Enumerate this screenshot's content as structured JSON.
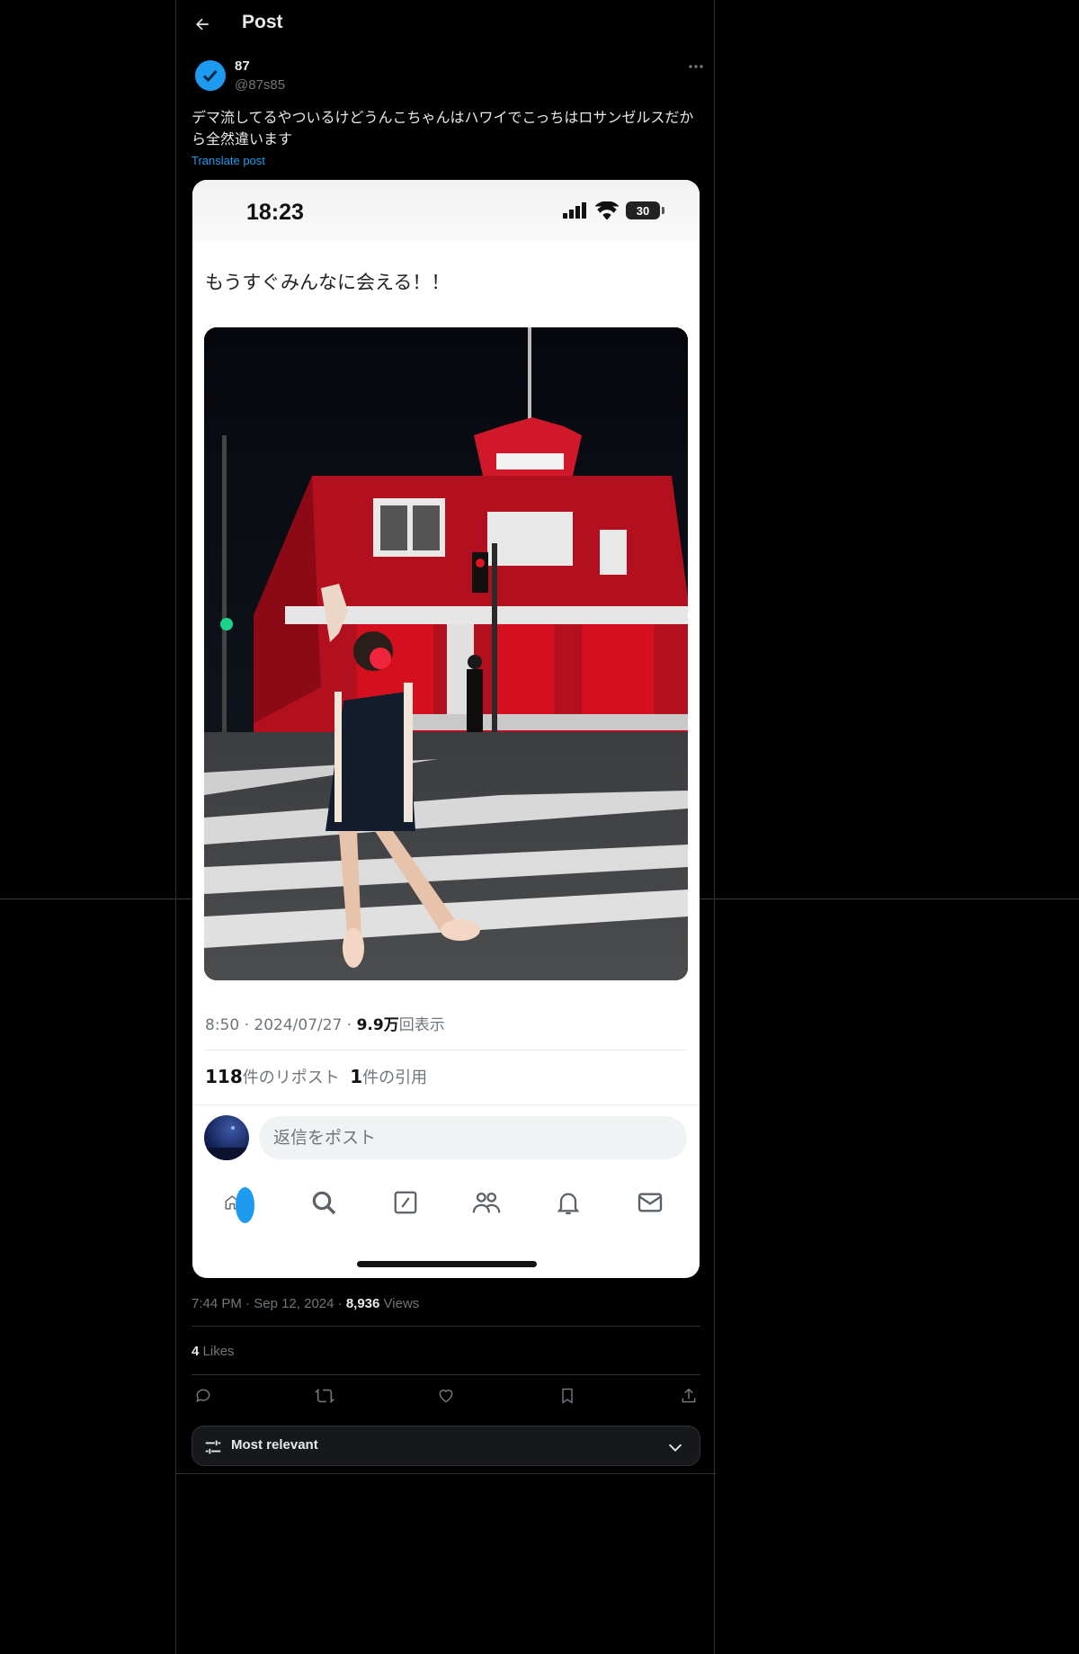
{
  "header": {
    "title": "Post"
  },
  "author": {
    "name": "87",
    "handle": "@87s85"
  },
  "post": {
    "text": "デマ流してるやついるけどうんこちゃんはハワイでこっちはロサンゼルスだから全然違います",
    "translate_label": "Translate post"
  },
  "embedded": {
    "status_time": "18:23",
    "battery": "30",
    "tweet_text": "もうすぐみんなに会える！！",
    "time": "8:50 · 2024/07/27 · ",
    "views_count": "9.9万",
    "views_label": "回表示",
    "reposts_count": "118",
    "reposts_label": "件のリポスト",
    "quotes_count": "1",
    "quotes_label": "件の引用",
    "reply_placeholder": "返信をポスト"
  },
  "meta": {
    "time": "7:44 PM",
    "date": "Sep 12, 2024",
    "views_count": "8,936",
    "views_label": "Views",
    "likes_count": "4",
    "likes_label": "Likes"
  },
  "sort": {
    "label": "Most relevant"
  },
  "icons": {
    "back": "arrow-left-icon",
    "verified": "verified-badge-icon",
    "more": "more-dots-icon",
    "reply": "reply-icon",
    "repost": "repost-icon",
    "like": "heart-icon",
    "bookmark": "bookmark-icon",
    "share": "share-icon",
    "sort": "sliders-icon",
    "chevron": "chevron-down-icon"
  },
  "colors": {
    "accent": "#1d9bf0",
    "background": "#000000",
    "muted": "#71767b"
  }
}
